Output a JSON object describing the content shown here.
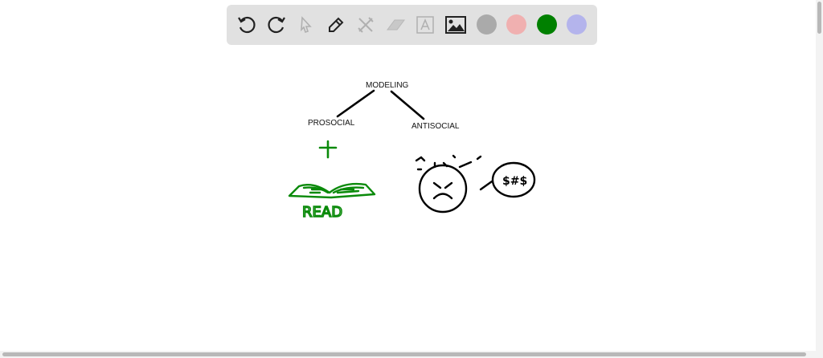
{
  "toolbar": {
    "tools": [
      "undo-icon",
      "redo-icon",
      "select-icon",
      "pen-icon",
      "tools-icon",
      "eraser-icon",
      "text-icon",
      "image-icon"
    ],
    "colors": [
      "#aaaaaa",
      "#f0b0b0",
      "#008000",
      "#b4b4ec"
    ]
  },
  "drawing": {
    "root": "MODELING",
    "left": "PROSOCIAL",
    "right": "ANTISOCIAL",
    "book_caption": "READ",
    "speech": "$#$",
    "ink_black": "#000000",
    "ink_green": "#0a8a0a"
  }
}
